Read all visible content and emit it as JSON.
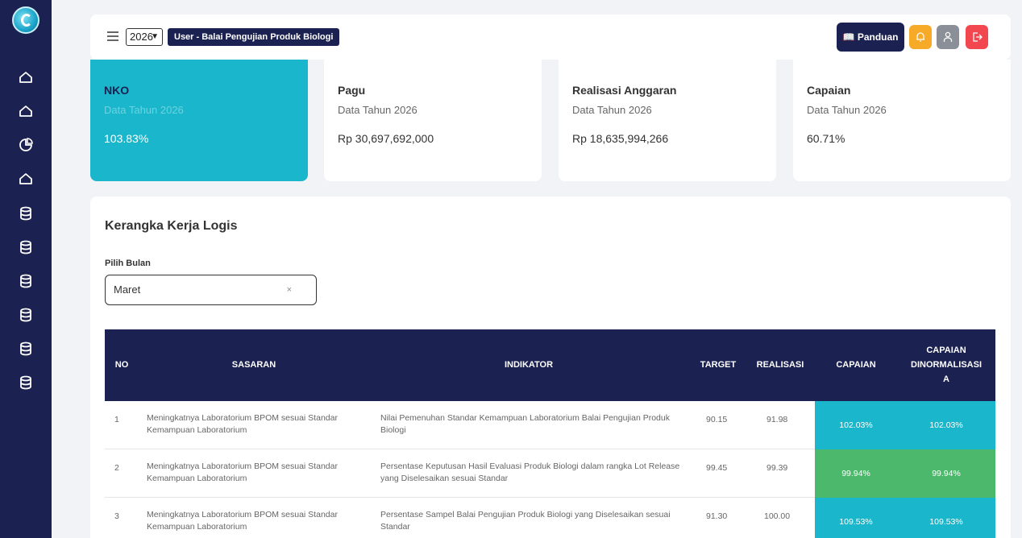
{
  "header": {
    "year": "2026",
    "user": "User - Balai Pengujian Produk Biologi",
    "panduan_label": "Panduan"
  },
  "cards": [
    {
      "title": "NKO",
      "sub": "Data Tahun 2026",
      "value": "103.83%"
    },
    {
      "title": "Pagu",
      "sub": "Data Tahun 2026",
      "value": "Rp 30,697,692,000"
    },
    {
      "title": "Realisasi Anggaran",
      "sub": "Data Tahun 2026",
      "value": "Rp 18,635,994,266"
    },
    {
      "title": "Capaian",
      "sub": "Data Tahun 2026",
      "value": "60.71%"
    }
  ],
  "panel": {
    "title": "Kerangka Kerja Logis",
    "month_label": "Pilih Bulan",
    "month_value": "Maret",
    "clear_symbol": "×"
  },
  "table": {
    "headers": {
      "no": "NO",
      "sasaran": "SASARAN",
      "indikator": "INDIKATOR",
      "target": "TARGET",
      "realisasi": "REALISASI",
      "capaian": "CAPAIAN",
      "capaian_norm_1": "CAPAIAN",
      "capaian_norm_2": "DINORMALISASI",
      "capaian_norm_3": "A"
    },
    "rows": [
      {
        "no": "1",
        "sasaran_1": "Meningkatnya Laboratorium BPOM sesuai Standar",
        "sasaran_2": "Kemampuan Laboratorium",
        "indikator_1": "Nilai Pemenuhan Standar Kemampuan Laboratorium Balai Pengujian Produk",
        "indikator_2": "Biologi",
        "target": "90.15",
        "realisasi": "91.98",
        "capaian": "102.03%",
        "capaian_norm": "102.03%"
      },
      {
        "no": "2",
        "sasaran_1": "Meningkatnya Laboratorium BPOM sesuai Standar",
        "sasaran_2": "Kemampuan Laboratorium",
        "indikator_1": "Persentase Keputusan Hasil Evaluasi Produk Biologi dalam rangka Lot Release",
        "indikator_2": "yang Diselesaikan sesuai Standar",
        "target": "99.45",
        "realisasi": "99.39",
        "capaian": "99.94%",
        "capaian_norm": "99.94%"
      },
      {
        "no": "3",
        "sasaran_1": "Meningkatnya Laboratorium BPOM sesuai Standar",
        "sasaran_2": "Kemampuan Laboratorium",
        "indikator_1": "Persentase Sampel Balai Pengujian Produk Biologi yang Diselesaikan sesuai",
        "indikator_2": "Standar",
        "target": "91.30",
        "realisasi": "100.00",
        "capaian": "109.53%",
        "capaian_norm": "109.53%"
      }
    ]
  },
  "colors": {
    "navy": "#1b2150",
    "cyan": "#19b6cc",
    "green": "#4cb86b",
    "warning": "#f7a928",
    "gray": "#8a8f98",
    "danger": "#f2474f"
  },
  "icons": {
    "sidebar": [
      "home-icon",
      "home-icon",
      "pie-chart-icon",
      "home-icon",
      "database-icon",
      "database-icon",
      "database-icon",
      "database-icon",
      "database-icon",
      "database-icon"
    ],
    "header": [
      "menu-icon",
      "book-icon",
      "bell-icon",
      "user-icon",
      "logout-icon"
    ]
  }
}
